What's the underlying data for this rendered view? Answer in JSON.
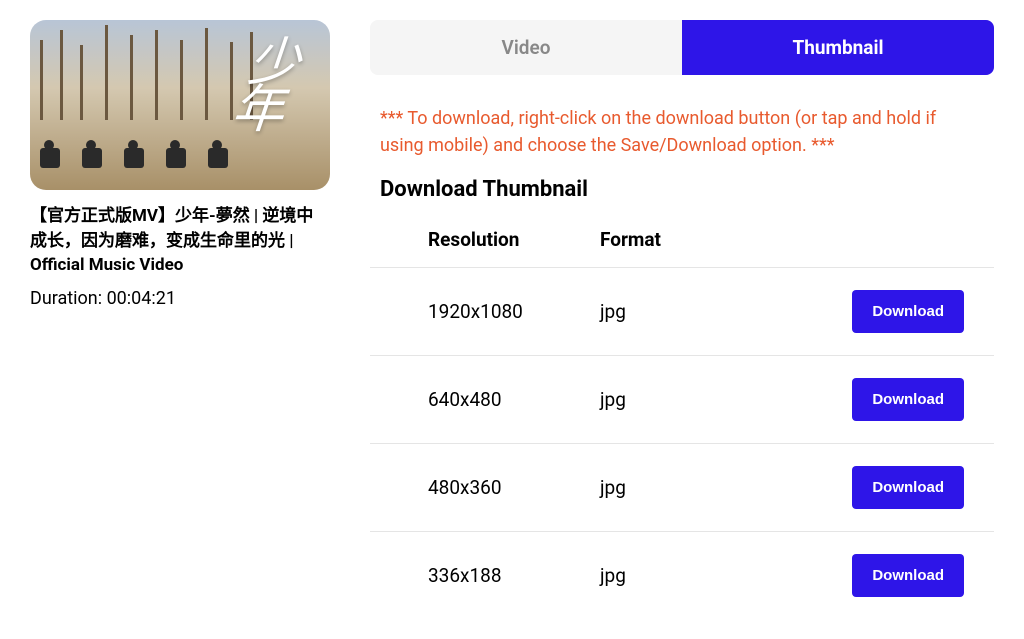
{
  "video": {
    "title": "【官方正式版MV】少年-夢然 | 逆境中成长，因为磨难，变成生命里的光 | Official Music Video",
    "duration_label": "Duration: 00:04:21",
    "overlay_char1": "少",
    "overlay_char2": "年"
  },
  "tabs": {
    "video": "Video",
    "thumbnail": "Thumbnail"
  },
  "instruction": "*** To download, right-click on the download button (or tap and hold if using mobile) and choose the Save/Download option. ***",
  "section_title": "Download Thumbnail",
  "table": {
    "headers": {
      "resolution": "Resolution",
      "format": "Format"
    },
    "rows": [
      {
        "resolution": "1920x1080",
        "format": "jpg",
        "action": "Download"
      },
      {
        "resolution": "640x480",
        "format": "jpg",
        "action": "Download"
      },
      {
        "resolution": "480x360",
        "format": "jpg",
        "action": "Download"
      },
      {
        "resolution": "336x188",
        "format": "jpg",
        "action": "Download"
      }
    ]
  }
}
